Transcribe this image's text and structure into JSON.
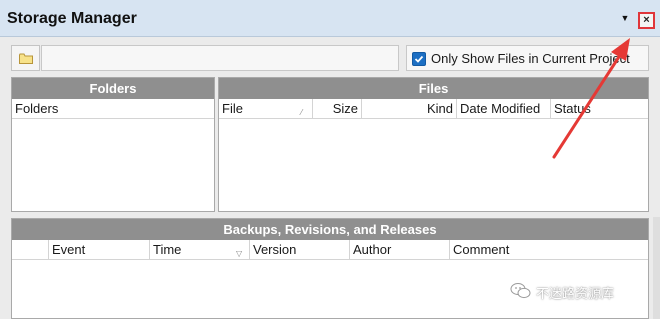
{
  "window": {
    "title": "Storage Manager",
    "pin_icon": "dropdown-triangle-icon",
    "close_icon": "close-icon",
    "close_glyph": "×",
    "highlight_color": "#e0353a"
  },
  "toolbar": {
    "folder_icon": "folder-icon",
    "path_value": "",
    "only_current_project_checked": true,
    "only_current_project_label": "Only Show Files in Current Project"
  },
  "folders_panel": {
    "header": "Folders",
    "columns": [
      "Folders"
    ],
    "rows": []
  },
  "files_panel": {
    "header": "Files",
    "columns": [
      "File",
      "Size",
      "Kind",
      "Date Modified",
      "Status"
    ],
    "rows": []
  },
  "backups_panel": {
    "header": "Backups, Revisions, and Releases",
    "columns": [
      "",
      "Event",
      "Time",
      "Version",
      "Author",
      "Comment"
    ],
    "rows": []
  },
  "watermark": {
    "icon": "wechat-icon",
    "text": "不迷路资源库"
  },
  "annotation": {
    "arrow_color": "#e53935"
  }
}
